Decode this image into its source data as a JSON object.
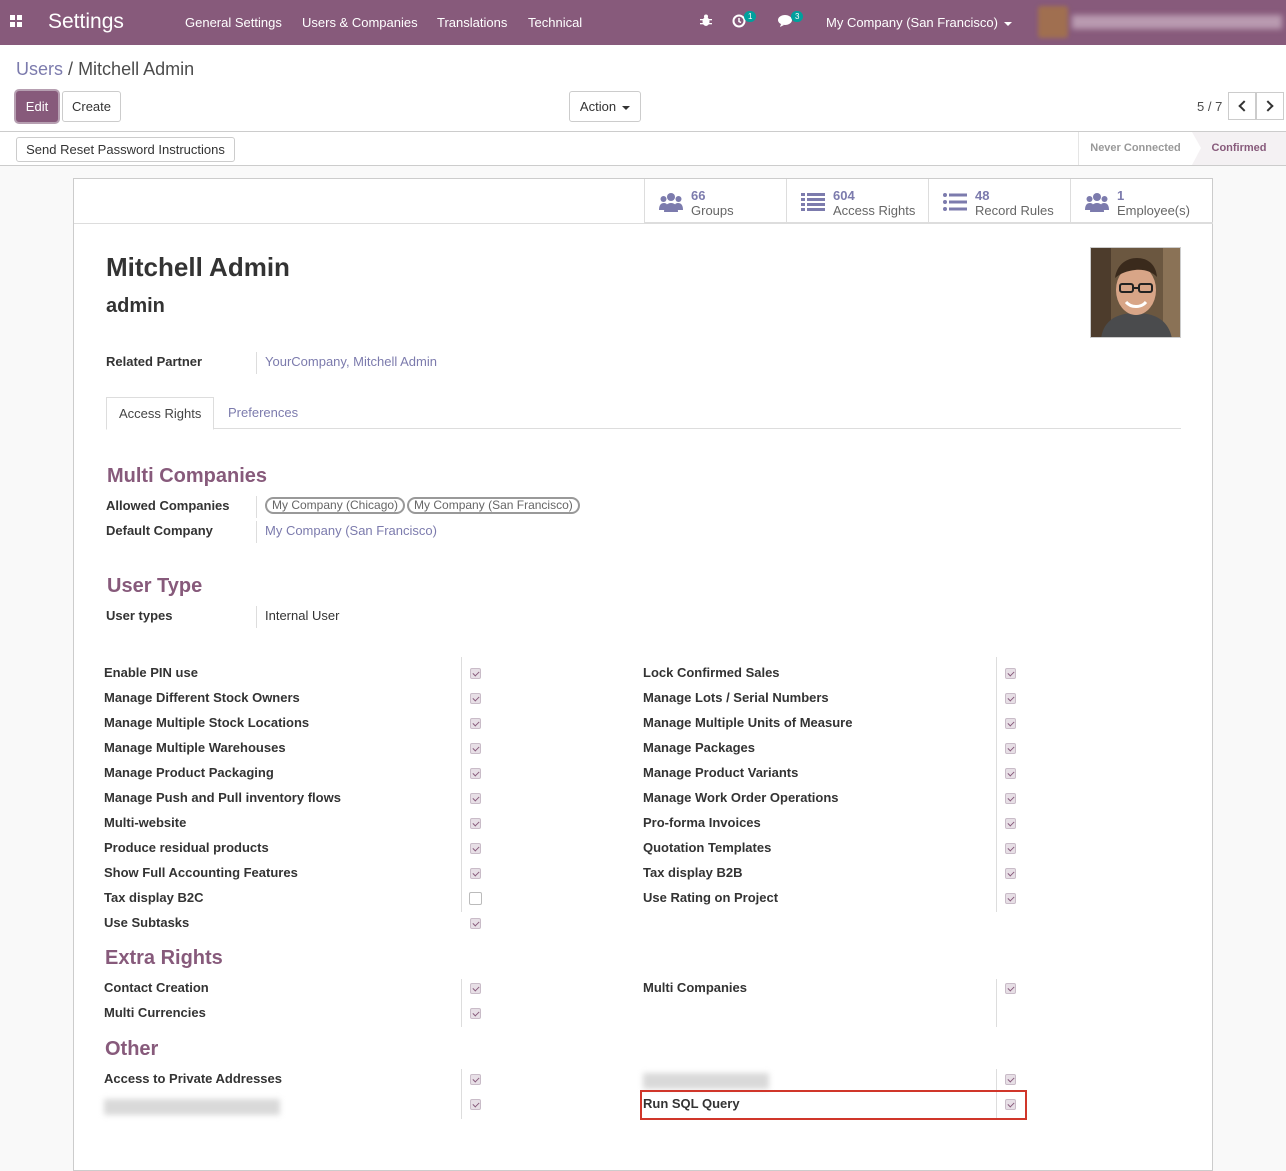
{
  "navbar": {
    "brand": "Settings",
    "menu": [
      "General Settings",
      "Users & Companies",
      "Translations",
      "Technical"
    ],
    "activity_count": "1",
    "messages_count": "3",
    "company": "My Company (San Francisco)"
  },
  "breadcrumb": {
    "parent": "Users",
    "separator": "/",
    "current": "Mitchell Admin"
  },
  "buttons": {
    "edit": "Edit",
    "create": "Create",
    "action": "Action"
  },
  "pager": {
    "value": "5 / 7"
  },
  "statusbar": {
    "reset_button": "Send Reset Password Instructions",
    "stage_never": "Never Connected",
    "stage_confirmed": "Confirmed"
  },
  "smart_buttons": [
    {
      "value": "66",
      "label": "Groups"
    },
    {
      "value": "604",
      "label": "Access Rights"
    },
    {
      "value": "48",
      "label": "Record Rules"
    },
    {
      "value": "1",
      "label": "Employee(s)"
    }
  ],
  "user": {
    "name": "Mitchell Admin",
    "login": "admin"
  },
  "fields": {
    "related_partner_label": "Related Partner",
    "related_partner_value": "YourCompany, Mitchell Admin",
    "allowed_companies_label": "Allowed Companies",
    "allowed_companies": [
      "My Company (Chicago)",
      "My Company (San Francisco)"
    ],
    "default_company_label": "Default Company",
    "default_company_value": "My Company (San Francisco)",
    "user_types_label": "User types",
    "user_types_value": "Internal User"
  },
  "tabs": [
    "Access Rights",
    "Preferences"
  ],
  "sections": {
    "multi_companies": "Multi Companies",
    "user_type": "User Type",
    "extra_rights": "Extra Rights",
    "other": "Other"
  },
  "technical_left": [
    {
      "label": "Enable PIN use",
      "checked": true
    },
    {
      "label": "Manage Different Stock Owners",
      "checked": true
    },
    {
      "label": "Manage Multiple Stock Locations",
      "checked": true
    },
    {
      "label": "Manage Multiple Warehouses",
      "checked": true
    },
    {
      "label": "Manage Product Packaging",
      "checked": true
    },
    {
      "label": "Manage Push and Pull inventory flows",
      "checked": true
    },
    {
      "label": "Multi-website",
      "checked": true
    },
    {
      "label": "Produce residual products",
      "checked": true
    },
    {
      "label": "Show Full Accounting Features",
      "checked": true
    },
    {
      "label": "Tax display B2C",
      "checked": false
    },
    {
      "label": "Use Subtasks",
      "checked": true
    }
  ],
  "technical_right": [
    {
      "label": "Lock Confirmed Sales",
      "checked": true
    },
    {
      "label": "Manage Lots / Serial Numbers",
      "checked": true
    },
    {
      "label": "Manage Multiple Units of Measure",
      "checked": true
    },
    {
      "label": "Manage Packages",
      "checked": true
    },
    {
      "label": "Manage Product Variants",
      "checked": true
    },
    {
      "label": "Manage Work Order Operations",
      "checked": true
    },
    {
      "label": "Pro-forma Invoices",
      "checked": true
    },
    {
      "label": "Quotation Templates",
      "checked": true
    },
    {
      "label": "Tax display B2B",
      "checked": true
    },
    {
      "label": "Use Rating on Project",
      "checked": true
    }
  ],
  "extra_rights": {
    "left": [
      {
        "label": "Contact Creation",
        "checked": true
      },
      {
        "label": "Multi Currencies",
        "checked": true
      }
    ],
    "right": [
      {
        "label": "Multi Companies",
        "checked": true
      }
    ]
  },
  "other": {
    "left_1": "Access to Private Addresses",
    "right_2": "Run SQL Query"
  }
}
